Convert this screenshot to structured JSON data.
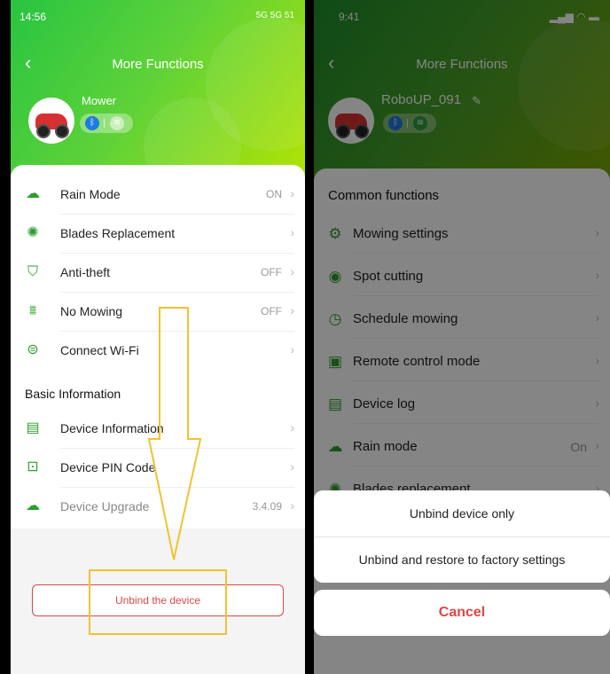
{
  "left": {
    "status": {
      "time": "14:56",
      "signal": "5G 5G 51"
    },
    "title": "More Functions",
    "device_name": "Mower",
    "items": [
      {
        "label": "Rain Mode",
        "value": "ON",
        "icon": "cloud-rain-icon"
      },
      {
        "label": "Blades Replacement",
        "value": "",
        "icon": "blade-icon"
      },
      {
        "label": "Anti-theft",
        "value": "OFF",
        "icon": "shield-alert-icon"
      },
      {
        "label": "No Mowing",
        "value": "OFF",
        "icon": "no-mowing-icon"
      },
      {
        "label": "Connect Wi-Fi",
        "value": "",
        "icon": "wifi-link-icon"
      }
    ],
    "section_basic": "Basic Information",
    "basic_items": [
      {
        "label": "Device Information",
        "value": "",
        "icon": "document-icon"
      },
      {
        "label": "Device PIN Code",
        "value": "",
        "icon": "lock-icon"
      },
      {
        "label": "Device Upgrade",
        "value": "3.4.09",
        "icon": "cloud-upload-icon"
      }
    ],
    "unbind_label": "Unbind the device"
  },
  "right": {
    "status": {
      "time": "9:41"
    },
    "title": "More Functions",
    "device_name": "RoboUP_091",
    "section_common": "Common functions",
    "items": [
      {
        "label": "Mowing settings",
        "value": "",
        "icon": "gear-icon"
      },
      {
        "label": "Spot cutting",
        "value": "",
        "icon": "location-pin-icon"
      },
      {
        "label": "Schedule mowing",
        "value": "",
        "icon": "clock-icon"
      },
      {
        "label": "Remote control mode",
        "value": "",
        "icon": "remote-icon"
      },
      {
        "label": "Device log",
        "value": "",
        "icon": "log-icon"
      },
      {
        "label": "Rain mode",
        "value": "On",
        "icon": "cloud-rain-icon"
      },
      {
        "label": "Blades replacement",
        "value": "",
        "icon": "blade-icon"
      }
    ],
    "actions": {
      "unbind_only": "Unbind device only",
      "unbind_restore": "Unbind and restore to factory settings",
      "cancel": "Cancel"
    }
  },
  "colors": {
    "accent_green": "#2e9e2e",
    "danger_red": "#d94848",
    "highlight_yellow": "#f2c22e"
  }
}
